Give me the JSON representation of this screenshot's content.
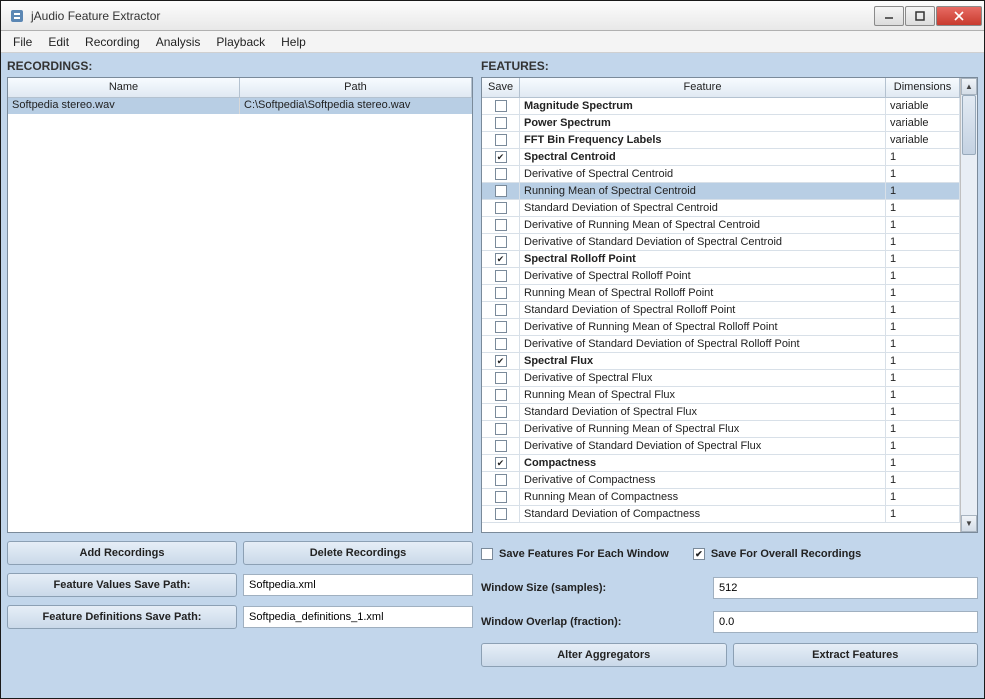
{
  "window": {
    "title": "jAudio Feature Extractor"
  },
  "menu": [
    "File",
    "Edit",
    "Recording",
    "Analysis",
    "Playback",
    "Help"
  ],
  "recordings": {
    "label": "RECORDINGS:",
    "headers": {
      "name": "Name",
      "path": "Path"
    },
    "rows": [
      {
        "name": "Softpedia stereo.wav",
        "path": "C:\\Softpedia\\Softpedia stereo.wav",
        "selected": true
      }
    ]
  },
  "features": {
    "label": "FEATURES:",
    "headers": {
      "save": "Save",
      "feature": "Feature",
      "dim": "Dimensions"
    },
    "rows": [
      {
        "save": false,
        "feature": "Magnitude Spectrum",
        "dim": "variable",
        "bold": true
      },
      {
        "save": false,
        "feature": "Power Spectrum",
        "dim": "variable",
        "bold": true
      },
      {
        "save": false,
        "feature": "FFT Bin Frequency Labels",
        "dim": "variable",
        "bold": true
      },
      {
        "save": true,
        "feature": "Spectral Centroid",
        "dim": "1",
        "bold": true
      },
      {
        "save": false,
        "feature": "Derivative of Spectral Centroid",
        "dim": "1"
      },
      {
        "save": false,
        "feature": "Running Mean of Spectral Centroid",
        "dim": "1",
        "selected": true
      },
      {
        "save": false,
        "feature": "Standard Deviation of Spectral Centroid",
        "dim": "1"
      },
      {
        "save": false,
        "feature": "Derivative of Running Mean of Spectral Centroid",
        "dim": "1"
      },
      {
        "save": false,
        "feature": "Derivative of Standard Deviation of Spectral Centroid",
        "dim": "1"
      },
      {
        "save": true,
        "feature": "Spectral Rolloff Point",
        "dim": "1",
        "bold": true
      },
      {
        "save": false,
        "feature": "Derivative of Spectral Rolloff Point",
        "dim": "1"
      },
      {
        "save": false,
        "feature": "Running Mean of Spectral Rolloff Point",
        "dim": "1"
      },
      {
        "save": false,
        "feature": "Standard Deviation of Spectral Rolloff Point",
        "dim": "1"
      },
      {
        "save": false,
        "feature": "Derivative of Running Mean of Spectral Rolloff Point",
        "dim": "1"
      },
      {
        "save": false,
        "feature": "Derivative of Standard Deviation of Spectral Rolloff Point",
        "dim": "1"
      },
      {
        "save": true,
        "feature": "Spectral Flux",
        "dim": "1",
        "bold": true
      },
      {
        "save": false,
        "feature": "Derivative of Spectral Flux",
        "dim": "1"
      },
      {
        "save": false,
        "feature": "Running Mean of Spectral Flux",
        "dim": "1"
      },
      {
        "save": false,
        "feature": "Standard Deviation of Spectral Flux",
        "dim": "1"
      },
      {
        "save": false,
        "feature": "Derivative of Running Mean of Spectral Flux",
        "dim": "1"
      },
      {
        "save": false,
        "feature": "Derivative of Standard Deviation of Spectral Flux",
        "dim": "1"
      },
      {
        "save": true,
        "feature": "Compactness",
        "dim": "1",
        "bold": true
      },
      {
        "save": false,
        "feature": "Derivative of Compactness",
        "dim": "1"
      },
      {
        "save": false,
        "feature": "Running Mean of Compactness",
        "dim": "1"
      },
      {
        "save": false,
        "feature": "Standard Deviation of Compactness",
        "dim": "1"
      }
    ]
  },
  "buttons": {
    "add_rec": "Add Recordings",
    "del_rec": "Delete Recordings",
    "feat_values_path_label": "Feature Values Save Path:",
    "feat_defs_path_label": "Feature Definitions Save Path:",
    "alter_agg": "Alter Aggregators",
    "extract": "Extract Features"
  },
  "paths": {
    "values": "Softpedia.xml",
    "defs": "Softpedia_definitions_1.xml"
  },
  "options": {
    "save_each_window": {
      "label": "Save Features For Each Window",
      "checked": false
    },
    "save_overall": {
      "label": "Save For Overall Recordings",
      "checked": true
    },
    "window_size_label": "Window Size (samples):",
    "window_size": "512",
    "window_overlap_label": "Window Overlap (fraction):",
    "window_overlap": "0.0"
  }
}
